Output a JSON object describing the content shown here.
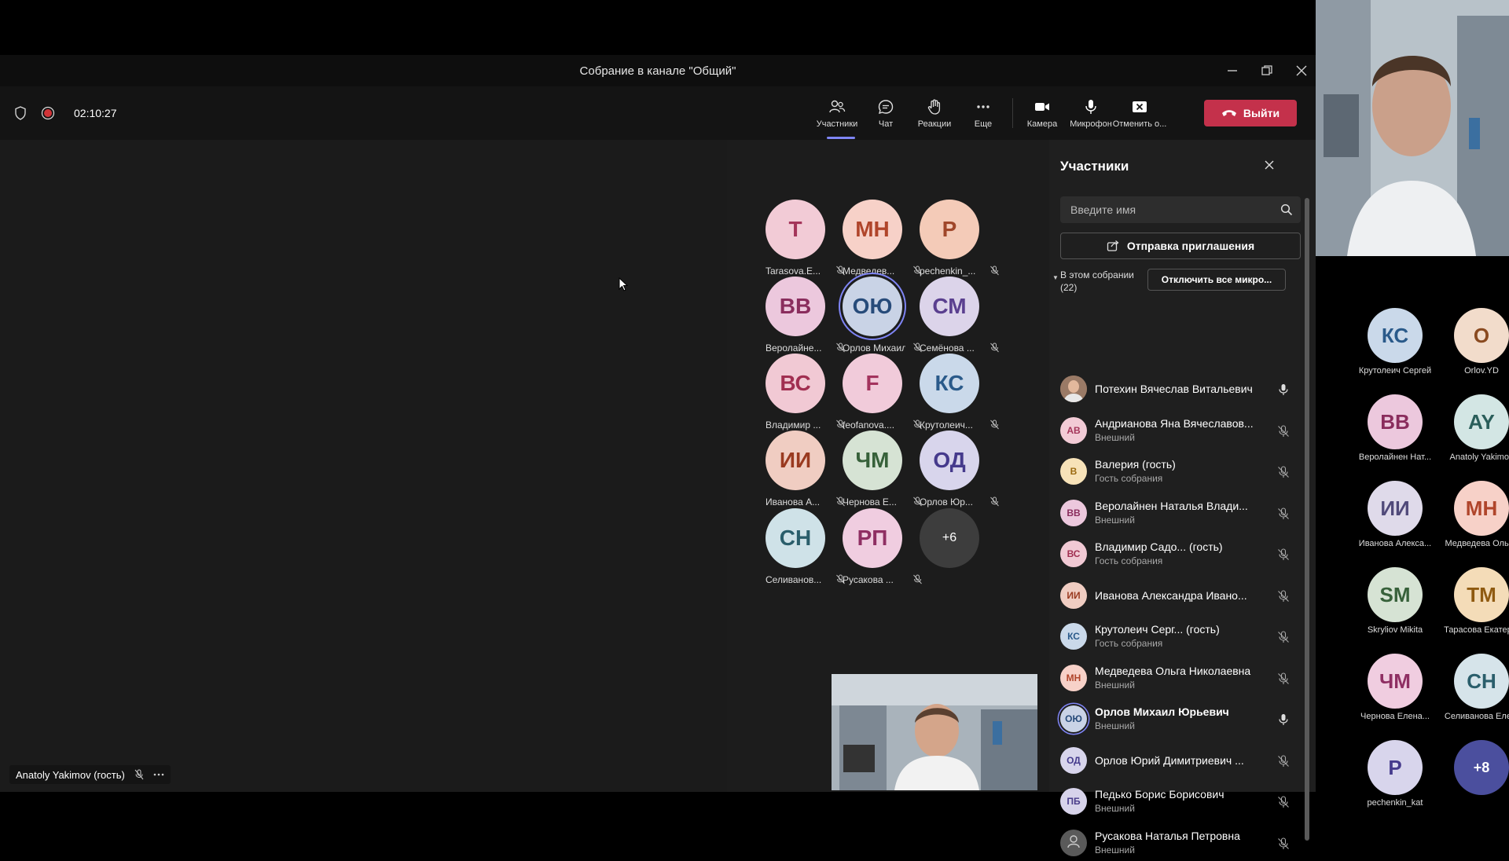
{
  "window": {
    "title": "Собрание в канале \"Общий\""
  },
  "toolbar": {
    "timer": "02:10:27",
    "participants_label": "Участники",
    "chat_label": "Чат",
    "reactions_label": "Реакции",
    "more_label": "Еще",
    "camera_label": "Камера",
    "mic_label": "Микрофон",
    "share_label": "Отменить о...",
    "leave_label": "Выйти"
  },
  "gallery": {
    "tiles": [
      {
        "initials": "T",
        "name": "Tarasova.E...",
        "bg": "#f2cbd6",
        "fg": "#a4355a"
      },
      {
        "initials": "МН",
        "name": "Медведев...",
        "bg": "#f7d1c8",
        "fg": "#b0452b"
      },
      {
        "initials": "P",
        "name": "pechenkin_...",
        "bg": "#f4cbb8",
        "fg": "#a0472a"
      },
      {
        "initials": "ВВ",
        "name": "Веролайне...",
        "bg": "#ecc8dd",
        "fg": "#8a2d5d"
      },
      {
        "initials": "ОЮ",
        "name": "Орлов Михаил...",
        "bg": "#c9d3e6",
        "fg": "#274b7a"
      },
      {
        "initials": "СМ",
        "name": "Семёнова ...",
        "bg": "#dcd4ea",
        "fg": "#5a3f8f"
      },
      {
        "initials": "ВС",
        "name": "Владимир ...",
        "bg": "#f1c9d4",
        "fg": "#a12f51"
      },
      {
        "initials": "F",
        "name": "feofanova....",
        "bg": "#f1cbda",
        "fg": "#a3335d"
      },
      {
        "initials": "КС",
        "name": "Крутолеич...",
        "bg": "#cad9ea",
        "fg": "#2a5a8a"
      },
      {
        "initials": "ИИ",
        "name": "Иванова А...",
        "bg": "#f0cdc2",
        "fg": "#9a3a20"
      },
      {
        "initials": "ЧМ",
        "name": "Чернова Е...",
        "bg": "#d6e3d4",
        "fg": "#37613a"
      },
      {
        "initials": "ОД",
        "name": "Орлов Юр...",
        "bg": "#d8d5ec",
        "fg": "#453a8c"
      },
      {
        "initials": "СН",
        "name": "Селиванов...",
        "bg": "#cfe2e8",
        "fg": "#2a5e6b"
      },
      {
        "initials": "РП",
        "name": "Русакова ...",
        "bg": "#f0cde0",
        "fg": "#8f2f63"
      }
    ],
    "overflow_label": "+6"
  },
  "self_badge": {
    "name": "Anatoly Yakimov (гость)"
  },
  "panel": {
    "title": "Участники",
    "search_placeholder": "Введите имя",
    "invite_label": "Отправка приглашения",
    "section_title": "В этом собрании",
    "section_count": "(22)",
    "mute_all_label": "Отключить все микро...",
    "people": [
      {
        "initials": "",
        "name": "Потехин Вячеслав Витальевич",
        "sub": "",
        "mic": "on",
        "photo": true,
        "bg": "#8a6a55",
        "fg": "#fff"
      },
      {
        "initials": "АВ",
        "name": "Андрианова Яна Вячеславов...",
        "sub": "Внешний",
        "mic": "off",
        "bg": "#f2cbd6",
        "fg": "#a4355a"
      },
      {
        "initials": "В",
        "name": "Валерия (гость)",
        "sub": "Гость собрания",
        "mic": "off",
        "bg": "#f7e2b8",
        "fg": "#9a6a10"
      },
      {
        "initials": "ВВ",
        "name": "Веролайнен Наталья Влади...",
        "sub": "Внешний",
        "mic": "off",
        "bg": "#ecc8dd",
        "fg": "#8a2d5d"
      },
      {
        "initials": "ВС",
        "name": "Владимир Садо... (гость)",
        "sub": "Гость собрания",
        "mic": "off",
        "bg": "#f1c9d4",
        "fg": "#a12f51"
      },
      {
        "initials": "ИИ",
        "name": "Иванова Александра Ивано...",
        "sub": "",
        "mic": "off",
        "bg": "#f0cdc2",
        "fg": "#9a3a20"
      },
      {
        "initials": "КС",
        "name": "Крутолеич Серг... (гость)",
        "sub": "Гость собрания",
        "mic": "off",
        "bg": "#cad9ea",
        "fg": "#2a5a8a"
      },
      {
        "initials": "МН",
        "name": "Медведева Ольга Николаевна",
        "sub": "Внешний",
        "mic": "off",
        "bg": "#f7d1c8",
        "fg": "#b0452b"
      },
      {
        "initials": "ОЮ",
        "name": "Орлов Михаил Юрьевич",
        "sub": "Внешний",
        "mic": "on",
        "bold": true,
        "bg": "#c9d3e6",
        "fg": "#274b7a"
      },
      {
        "initials": "ОД",
        "name": "Орлов Юрий Димитриевич ...",
        "sub": "",
        "mic": "off",
        "bg": "#d8d5ec",
        "fg": "#453a8c"
      },
      {
        "initials": "ПБ",
        "name": "Педько Борис Борисович",
        "sub": "Внешний",
        "mic": "off",
        "bg": "#d7d3ea",
        "fg": "#4a3d8a"
      },
      {
        "initials": "",
        "name": "Русакова Наталья Петровна",
        "sub": "Внешний",
        "mic": "off",
        "generic": true,
        "bg": "#5a5a5a",
        "fg": "#ccc"
      }
    ]
  },
  "right_column": {
    "tiles": [
      {
        "initials": "КС",
        "name": "Крутолеич Сергей",
        "bg": "#cad9ea",
        "fg": "#2a5a8a"
      },
      {
        "initials": "O",
        "name": "Orlov.YD",
        "bg": "#f2dccb",
        "fg": "#8a4a20"
      },
      {
        "initials": "ВВ",
        "name": "Веролайнен Нат...",
        "bg": "#ecc8dd",
        "fg": "#8a2d5d"
      },
      {
        "initials": "AY",
        "name": "Anatoly Yakimov",
        "bg": "#d3e6e4",
        "fg": "#2a5e5a"
      },
      {
        "initials": "ИИ",
        "name": "Иванова Алекса...",
        "bg": "#dfdaea",
        "fg": "#514a7a"
      },
      {
        "initials": "МН",
        "name": "Медведева Ольг...",
        "bg": "#f7d1c8",
        "fg": "#b0452b"
      },
      {
        "initials": "SM",
        "name": "Skryliov Mikita",
        "bg": "#d6e3d4",
        "fg": "#37613a"
      },
      {
        "initials": "ТМ",
        "name": "Тарасова Екатер...",
        "bg": "#f4dcb8",
        "fg": "#8f5a10"
      },
      {
        "initials": "ЧМ",
        "name": "Чернова Елена...",
        "bg": "#f0cde0",
        "fg": "#8f2f63"
      },
      {
        "initials": "СН",
        "name": "Селиванова Еле...",
        "bg": "#d6e4ea",
        "fg": "#2a5e6b"
      },
      {
        "initials": "P",
        "name": "pechenkin_kat",
        "bg": "#d8d5ec",
        "fg": "#453a8c"
      }
    ],
    "overflow_label": "+8"
  },
  "colors": {
    "leave": "#c4314b",
    "accent": "#7f85f5",
    "record": "#d13438"
  }
}
